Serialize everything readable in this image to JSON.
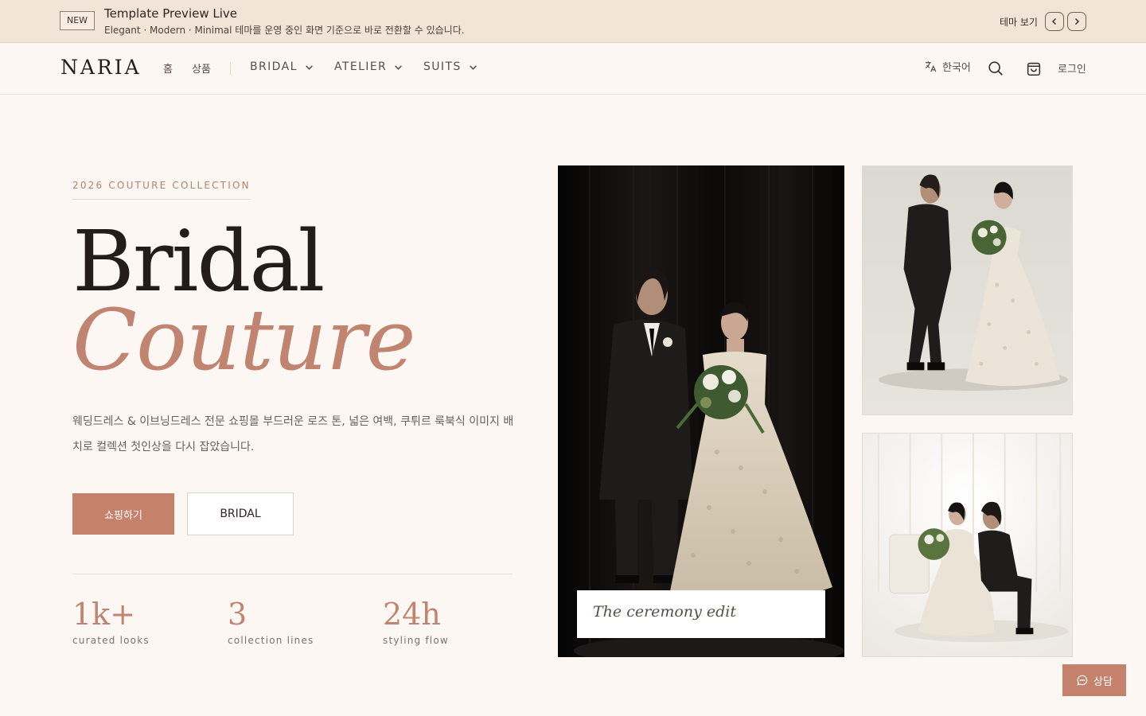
{
  "announcement": {
    "badge": "NEW",
    "title": "Template Preview Live",
    "subtitle": "Elegant · Modern · Minimal 테마를 운영 중인 화면 기준으로 바로 전환할 수 있습니다.",
    "theme_label": "테마 보기",
    "prev_icon": "chevron-left-icon",
    "next_icon": "chevron-right-icon"
  },
  "header": {
    "logo": "NARIA",
    "nav": {
      "home": "홈",
      "products": "상품",
      "bridal": "BRIDAL",
      "atelier": "ATELIER",
      "suits": "SUITS"
    },
    "language": "한국어",
    "login": "로그인",
    "icons": [
      "translate-icon",
      "search-icon",
      "shopping-bag-icon",
      "chevron-down-icon"
    ]
  },
  "hero": {
    "eyebrow": "2026 COUTURE COLLECTION",
    "title_line1": "Bridal",
    "title_line2": "Couture",
    "description": "웨딩드레스 & 이브닝드레스 전문 쇼핑몰 부드러운 로즈 톤, 넓은 여백, 쿠튀르 룩북식 이미지 배치로 컬렉션 첫인상을 다시 잡았습니다.",
    "primary_button": "쇼핑하기",
    "secondary_button": "BRIDAL",
    "stats": [
      {
        "value": "1k+",
        "label": "curated looks"
      },
      {
        "value": "3",
        "label": "collection lines"
      },
      {
        "value": "24h",
        "label": "styling flow"
      }
    ]
  },
  "gallery": {
    "caption": "The ceremony edit"
  },
  "chat": {
    "label": "상담",
    "icon": "chat-bubble-icon"
  },
  "colors": {
    "accent": "#c4826c",
    "announcement_bg": "#f2e4d6",
    "page_bg": "#fcf7f3",
    "heading": "#241c18"
  }
}
